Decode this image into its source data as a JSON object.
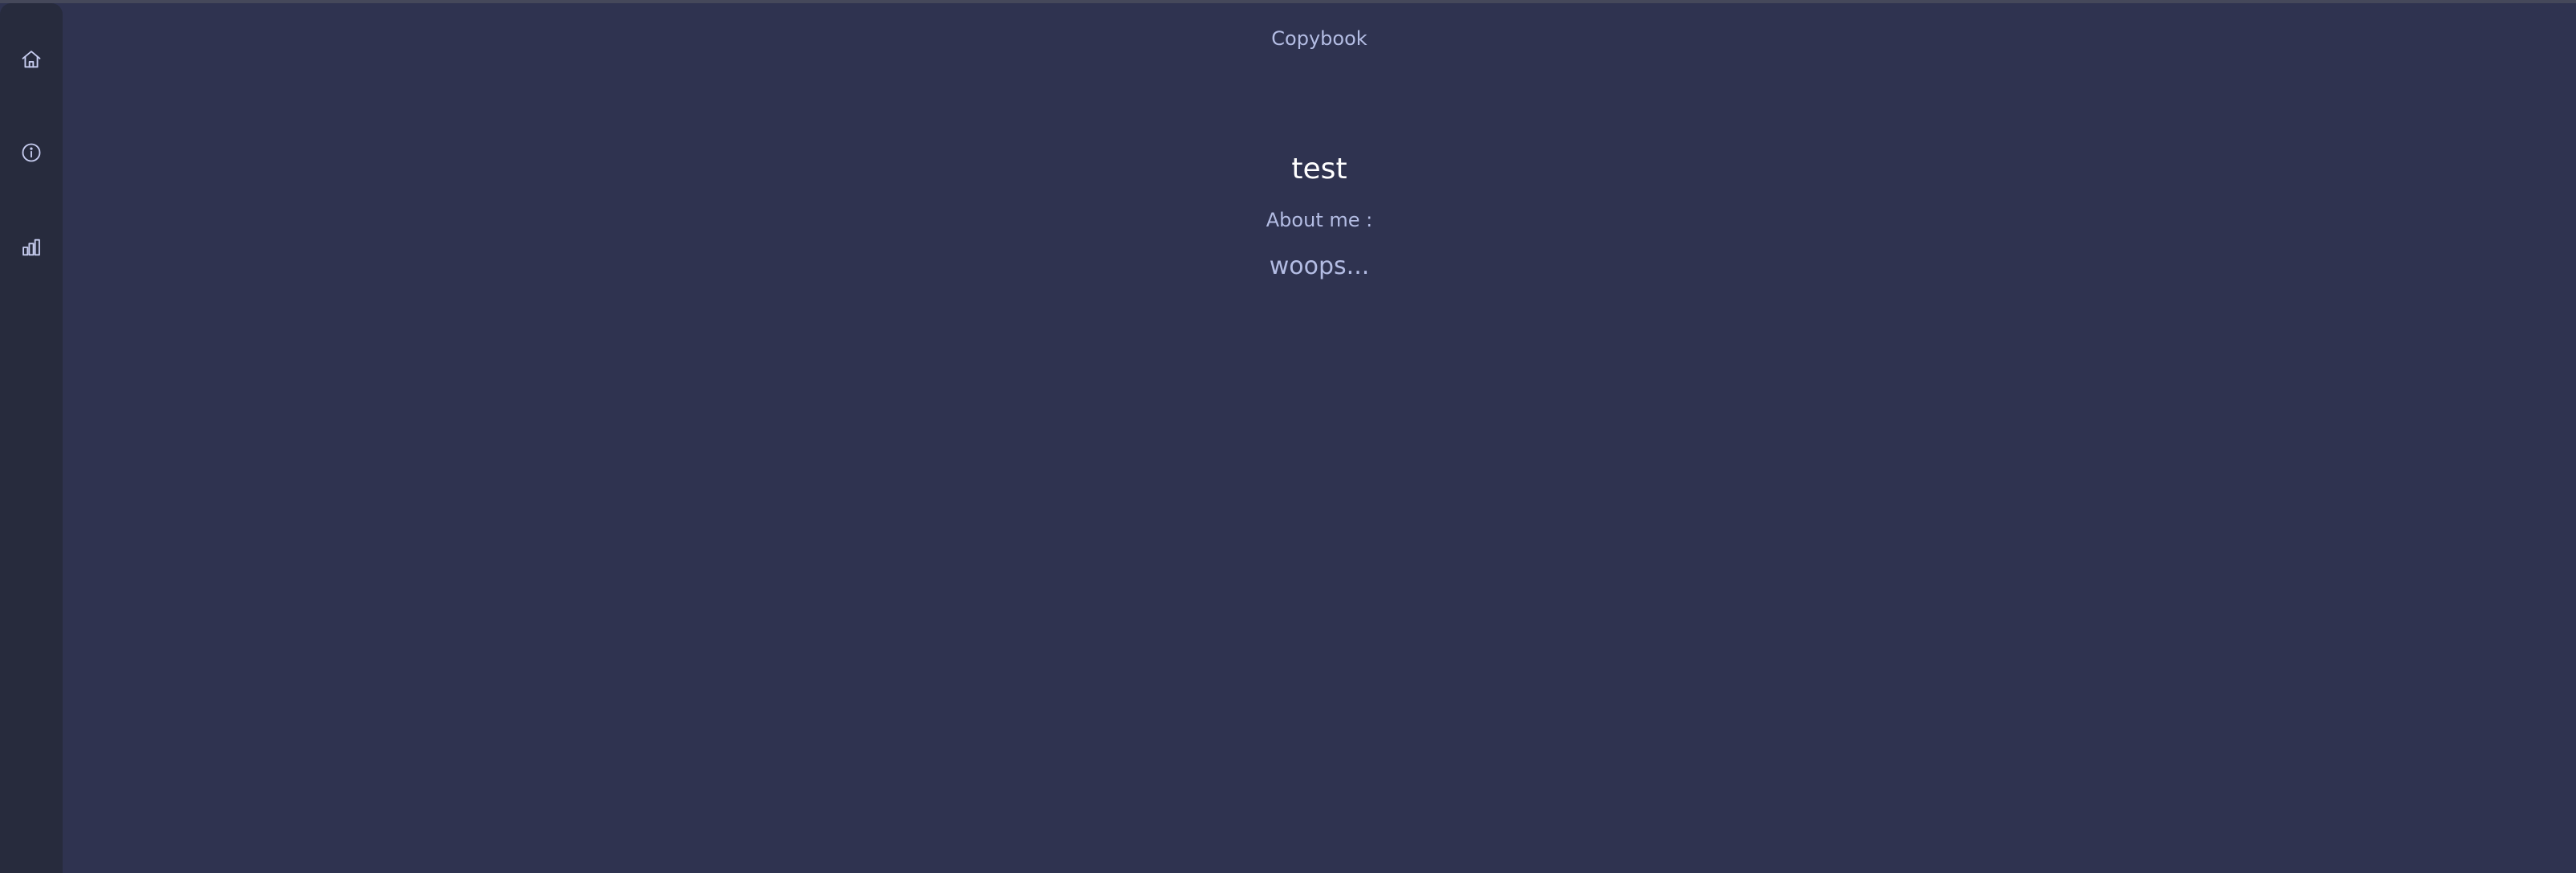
{
  "app": {
    "title": "Copybook"
  },
  "sidebar": {
    "items": [
      {
        "name": "home",
        "icon": "home-icon"
      },
      {
        "name": "info",
        "icon": "info-icon"
      },
      {
        "name": "stats",
        "icon": "bar-chart-icon"
      }
    ]
  },
  "profile": {
    "username": "test",
    "about_label": "About me :",
    "about_text": "woops..."
  },
  "colors": {
    "background": "#2f3350",
    "sidebar": "#272b3d",
    "accent_text": "#b4bde4",
    "heading_text": "#ffffff"
  }
}
